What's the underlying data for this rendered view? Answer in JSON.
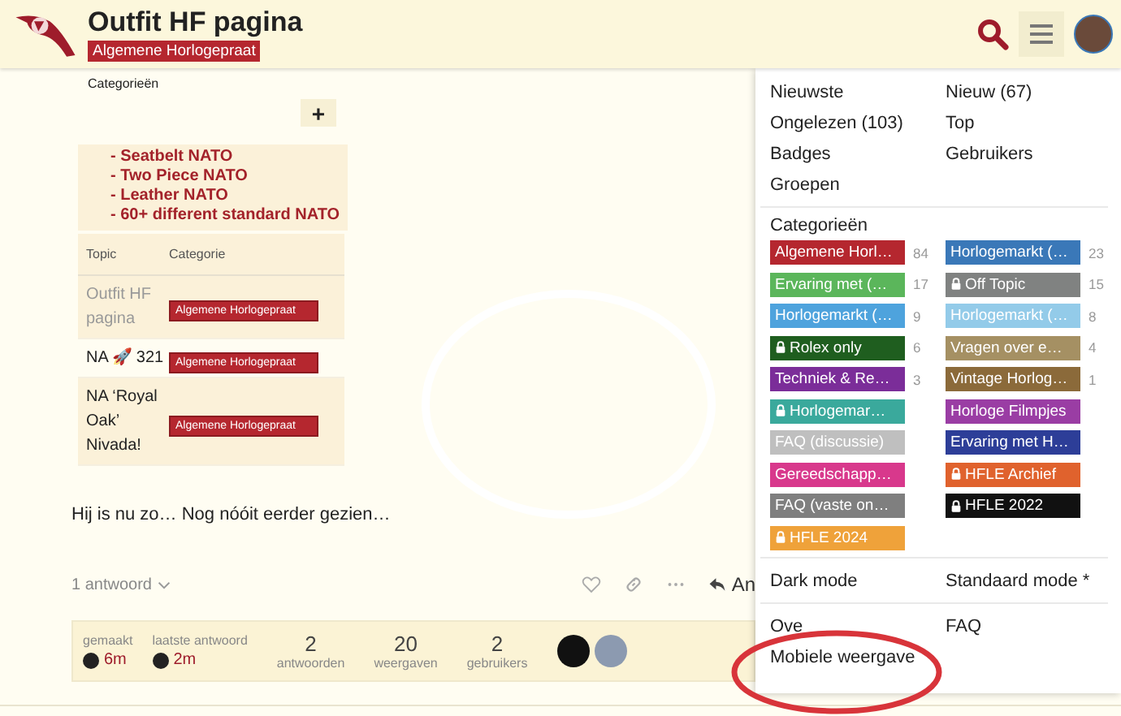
{
  "header": {
    "title": "Outfit HF pagina",
    "category": "Algemene Horlogepraat"
  },
  "post": {
    "widget_title": "Categorieën",
    "add_label": "+",
    "nato_lines": [
      "- Seatbelt NATO",
      "- Two Piece NATO",
      "- Leather NATO",
      "- 60+ different standard NATO"
    ],
    "table": {
      "columns": [
        "Topic",
        "Categorie"
      ],
      "rows": [
        {
          "topic": "Outfit HF pagina",
          "category": "Algemene Horlogepraat",
          "muted": true
        },
        {
          "topic": "NA 🚀 321",
          "category": "Algemene Horlogepraat",
          "muted": false
        },
        {
          "topic": "NA ‘Royal Oak’ Nivada!",
          "category": "Algemene Horlogepraat",
          "muted": false
        }
      ]
    },
    "text": "Hij is nu zo… Nog nóóit eerder gezien…",
    "replies": "1 antwoord",
    "reply_label": "An"
  },
  "stats": {
    "created_label": "gemaakt",
    "created": "6m",
    "last_label": "laatste antwoord",
    "last": "2m",
    "items": [
      {
        "value": "2",
        "label": "antwoorden"
      },
      {
        "value": "20",
        "label": "weergaven"
      },
      {
        "value": "2",
        "label": "gebruikers"
      }
    ]
  },
  "menu": {
    "links": [
      "Nieuwste",
      "Nieuw (67)",
      "Ongelezen (103)",
      "Top",
      "Badges",
      "Gebruikers",
      "Groepen"
    ],
    "categories_title": "Categorieën",
    "categories": [
      {
        "name": "Algemene Horl…",
        "count": "84",
        "color": "#b5272f",
        "locked": false
      },
      {
        "name": "Horlogemarkt (…",
        "count": "23",
        "color": "#3a78b8",
        "locked": false
      },
      {
        "name": "Ervaring met (…",
        "count": "17",
        "color": "#5bb65b",
        "locked": false
      },
      {
        "name": "Off Topic",
        "count": "15",
        "color": "#808281",
        "locked": true
      },
      {
        "name": "Horlogemarkt (…",
        "count": "9",
        "color": "#4ea3dd",
        "locked": false
      },
      {
        "name": "Horlogemarkt (…",
        "count": "8",
        "color": "#93cbe9",
        "locked": false
      },
      {
        "name": "Rolex only",
        "count": "6",
        "color": "#1f5e1f",
        "locked": true
      },
      {
        "name": "Vragen over e…",
        "count": "4",
        "color": "#a59063",
        "locked": false
      },
      {
        "name": "Techniek & Re…",
        "count": "3",
        "color": "#7b2d99",
        "locked": false
      },
      {
        "name": "Vintage Horlog…",
        "count": "1",
        "color": "#8b6a3a",
        "locked": false
      },
      {
        "name": "Horlogemar…",
        "color": "#3aa99c",
        "locked": true
      },
      {
        "name": "Horloge Filmpjes",
        "color": "#9a3da4",
        "locked": false
      },
      {
        "name": "FAQ (discussie)",
        "color": "#bfbfbf",
        "locked": false
      },
      {
        "name": "Ervaring met H…",
        "color": "#2d3e98",
        "locked": false
      },
      {
        "name": "Gereedschapp…",
        "color": "#d8388c",
        "locked": false
      },
      {
        "name": "HFLE Archief",
        "color": "#e0622d",
        "locked": true
      },
      {
        "name": "FAQ (vaste on…",
        "color": "#7f7f7f",
        "locked": false
      },
      {
        "name": "HFLE 2022",
        "color": "#111111",
        "locked": true
      },
      {
        "name": "HFLE 2024",
        "color": "#efa23a",
        "locked": true
      }
    ],
    "modes": [
      "Dark mode",
      "Standaard mode *"
    ],
    "footer_links": [
      "Ove",
      "FAQ",
      "Mobiele weergave"
    ]
  }
}
